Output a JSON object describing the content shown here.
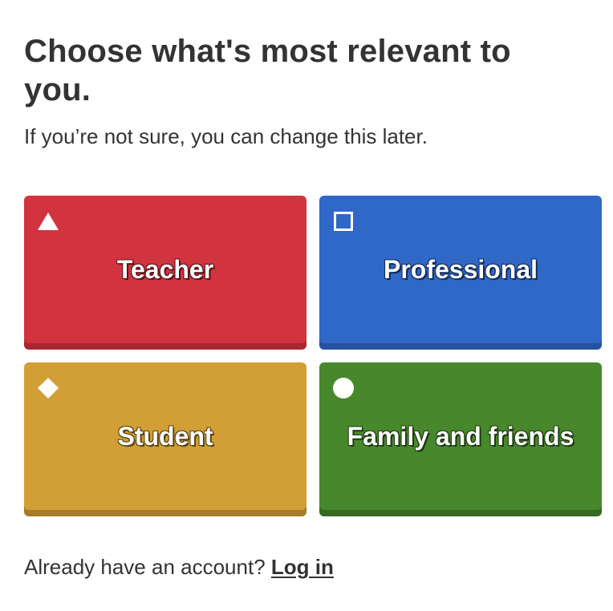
{
  "header": {
    "title": "Choose what's most relevant to you.",
    "subtitle": "If you’re not sure, you can change this later."
  },
  "options": [
    {
      "label": "Teacher",
      "icon": "triangle-icon",
      "color": "#d1333f"
    },
    {
      "label": "Professional",
      "icon": "square-icon",
      "color": "#2f68c7"
    },
    {
      "label": "Student",
      "icon": "diamond-icon",
      "color": "#d19f35"
    },
    {
      "label": "Family and friends",
      "icon": "circle-icon",
      "color": "#47882c"
    }
  ],
  "footer": {
    "prompt": "Already have an account?",
    "login_label": "Log in"
  }
}
